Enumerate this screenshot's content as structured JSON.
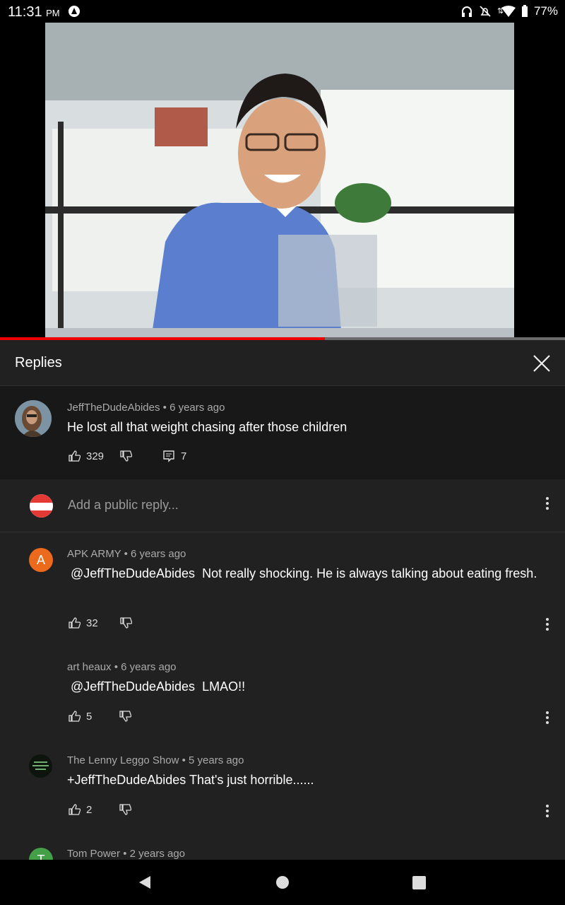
{
  "status_bar": {
    "time": "11:31",
    "ampm": "PM",
    "battery": "77%"
  },
  "video": {
    "progress": 0.575,
    "buffered": 0.92
  },
  "panel": {
    "title": "Replies"
  },
  "parent_comment": {
    "author": "JeffTheDudeAbides",
    "age": "6 years ago",
    "text": "He lost all that weight chasing after those children",
    "likes": "329",
    "replies": "7"
  },
  "reply_box": {
    "placeholder": "Add a public reply..."
  },
  "replies": [
    {
      "author": "APK ARMY",
      "age": "6 years ago",
      "mention": "@JeffTheDudeAbides",
      "text": "Not really shocking. He is always talking about eating fresh.",
      "likes": "32",
      "avatar_letter": "A",
      "avatar_color": "#ec6a1c"
    },
    {
      "author": "art heaux",
      "age": "6 years ago",
      "mention": "@JeffTheDudeAbides",
      "text": "LMAO!!",
      "likes": "5"
    },
    {
      "author": "The Lenny Leggo Show",
      "age": "5 years ago",
      "text": "+JeffTheDudeAbides That's just horrible......",
      "likes": "2"
    },
    {
      "author": "Tom Power",
      "age": "2 years ago",
      "avatar_letter": "T",
      "avatar_color": "#43a047"
    }
  ],
  "icons": [
    "thumbs-up-icon",
    "thumbs-down-icon",
    "reply-icon",
    "more-icon",
    "close-icon",
    "back-icon",
    "home-icon",
    "recents-icon"
  ]
}
